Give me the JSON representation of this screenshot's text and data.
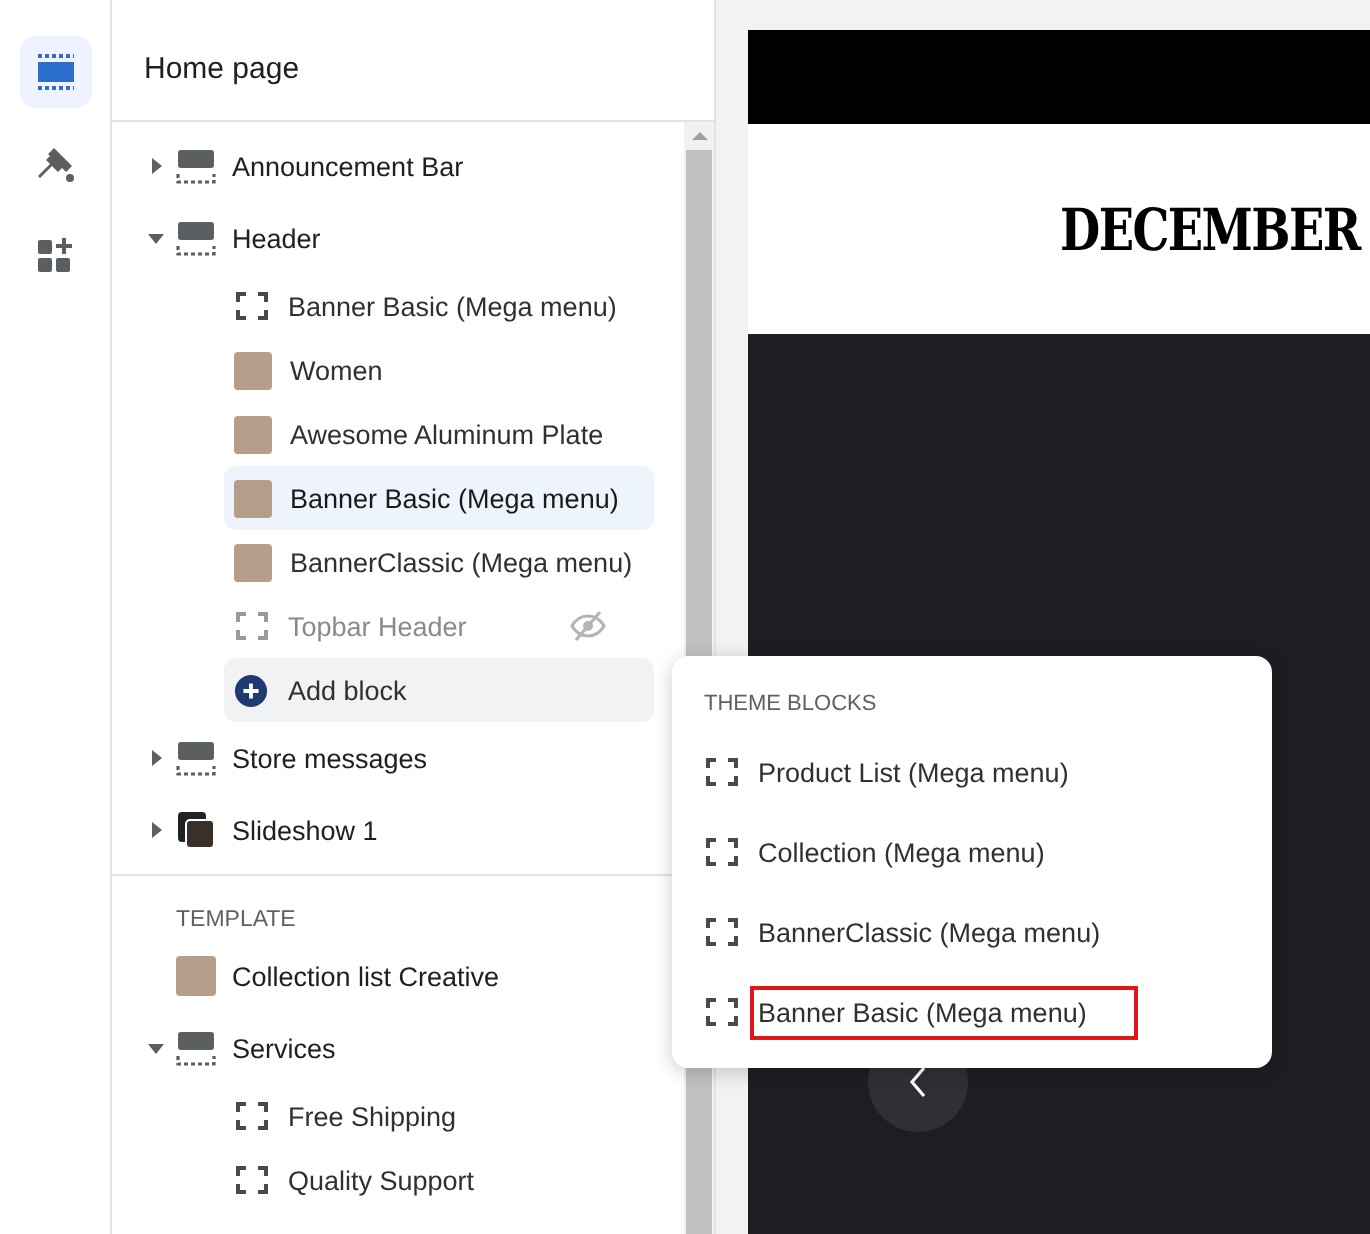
{
  "rail": [
    {
      "kind": "sections",
      "selected": true
    },
    {
      "kind": "brush",
      "selected": false
    },
    {
      "kind": "apps",
      "selected": false
    }
  ],
  "panel": {
    "title": "Home page",
    "groups": [
      {
        "sections": [
          {
            "label": "Announcement Bar",
            "kind": "section",
            "expanded": false
          },
          {
            "label": "Header",
            "kind": "section",
            "expanded": true,
            "children": [
              {
                "label": "Banner Basic (Mega menu)",
                "kind": "block",
                "selected": false,
                "hidden": false
              },
              {
                "label": "Women",
                "kind": "photo",
                "selected": false,
                "hidden": false
              },
              {
                "label": "Awesome Aluminum Plate",
                "kind": "photo",
                "selected": false,
                "hidden": false
              },
              {
                "label": "Banner Basic (Mega menu)",
                "kind": "photo",
                "selected": true,
                "hidden": false
              },
              {
                "label": "BannerClassic (Mega menu)",
                "kind": "photo",
                "selected": false,
                "hidden": false
              },
              {
                "label": "Topbar Header",
                "kind": "block",
                "selected": false,
                "hidden": true
              },
              {
                "label": "Add block",
                "kind": "add"
              }
            ]
          },
          {
            "label": "Store messages",
            "kind": "section",
            "expanded": false
          },
          {
            "label": "Slideshow 1",
            "kind": "slideshow",
            "expanded": false
          }
        ]
      },
      {
        "label": "TEMPLATE",
        "sections": [
          {
            "label": "Collection list Creative",
            "kind": "photo"
          },
          {
            "label": "Services",
            "kind": "section",
            "expanded": true,
            "children": [
              {
                "label": "Free Shipping",
                "kind": "block",
                "selected": false,
                "hidden": false
              },
              {
                "label": "Quality Support",
                "kind": "block",
                "selected": false,
                "hidden": false
              }
            ]
          }
        ]
      }
    ]
  },
  "preview": {
    "logo": "DECEMBER"
  },
  "popover": {
    "heading": "THEME BLOCKS",
    "items": [
      {
        "label": "Product List (Mega menu)",
        "outlined": false
      },
      {
        "label": "Collection (Mega menu)",
        "outlined": false
      },
      {
        "label": "BannerClassic (Mega menu)",
        "outlined": false
      },
      {
        "label": "Banner Basic (Mega menu)",
        "outlined": true
      }
    ]
  }
}
